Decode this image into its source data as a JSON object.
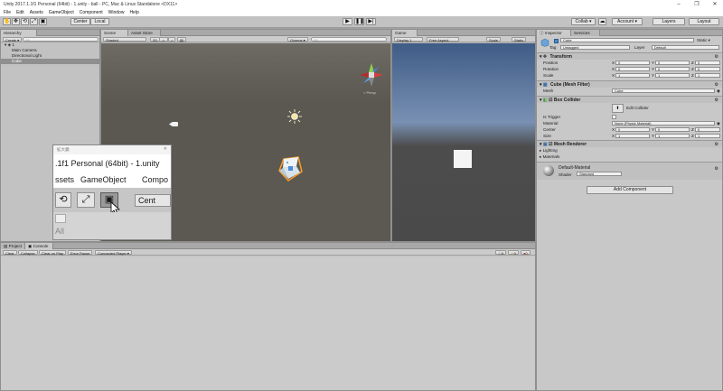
{
  "window": {
    "title": "Unity 2017.1.1f1 Personal (64bit) - 1.unity - ball - PC, Mac & Linux Standalone <DX11>"
  },
  "menu": [
    "File",
    "Edit",
    "Assets",
    "GameObject",
    "Component",
    "Window",
    "Help"
  ],
  "toolbar": {
    "center_label": "Center",
    "local_label": "Local",
    "collab_label": "Collab ▾",
    "account_label": "Account ▾",
    "layers_label": "Layers",
    "layout_label": "Layout"
  },
  "hierarchy": {
    "tab": "Hierarchy",
    "create_label": "Create ▾",
    "search_placeholder": "All",
    "scene_name": "1",
    "items": [
      "Main Camera",
      "Directional Light",
      "Cube"
    ]
  },
  "scene": {
    "tabs": [
      "Scene",
      "Asset Store"
    ],
    "shading": "Shaded",
    "mode_2d": "2D",
    "gizmos_label": "Gizmos ▾",
    "search_placeholder": "All",
    "persp_label": "< Persp"
  },
  "game": {
    "tab": "Game",
    "display": "Display 1",
    "aspect": "Free Aspect",
    "scale_label": "Scale",
    "static_label": "Static"
  },
  "inspector": {
    "tabs": [
      "Inspector",
      "Services"
    ],
    "object_name": "Cube",
    "static_label": "Static ▾",
    "tag_label": "Tag",
    "tag_value": "Untagged",
    "layer_label": "Layer",
    "layer_value": "Default",
    "transform": {
      "title": "Transform",
      "rows": [
        {
          "label": "Position",
          "x": "0",
          "y": "0",
          "z": "0"
        },
        {
          "label": "Rotation",
          "x": "0",
          "y": "0",
          "z": "0"
        },
        {
          "label": "Scale",
          "x": "1",
          "y": "1",
          "z": "1"
        }
      ]
    },
    "mesh_filter": {
      "title": "Cube (Mesh Filter)",
      "mesh_label": "Mesh",
      "mesh_value": "Cube"
    },
    "box_collider": {
      "title": "Box Collider",
      "edit_label": "Edit Collider",
      "trigger_label": "Is Trigger",
      "material_label": "Material",
      "material_value": "None (Physic Material)",
      "center": {
        "label": "Center",
        "x": "0",
        "y": "0",
        "z": "0"
      },
      "size": {
        "label": "Size",
        "x": "1",
        "y": "1",
        "z": "1"
      }
    },
    "mesh_renderer": {
      "title": "Mesh Renderer",
      "lighting": "Lighting",
      "materials": "Materials"
    },
    "material": {
      "name": "Default-Material",
      "shader_label": "Shader",
      "shader_value": "Standard"
    },
    "add_component": "Add Component"
  },
  "console": {
    "tabs": [
      "Project",
      "Console"
    ],
    "buttons": [
      "Clear",
      "Collapse",
      "Clear on Play",
      "Error Pause",
      "Connected Player ▾"
    ],
    "counts": [
      "0",
      "0",
      "0"
    ]
  },
  "zoom": {
    "title": "拡大鏡",
    "line1": ".1f1 Personal (64bit) - 1.unity",
    "menu": [
      "ssets",
      "GameObject",
      "Compo"
    ],
    "center_label": "Cent",
    "search_text": "All"
  },
  "colors": {
    "panel": "#c2c2c2",
    "selection": "#8f8f8f",
    "scene_ground": "#5c5852",
    "game_sky": "#7990b3"
  }
}
